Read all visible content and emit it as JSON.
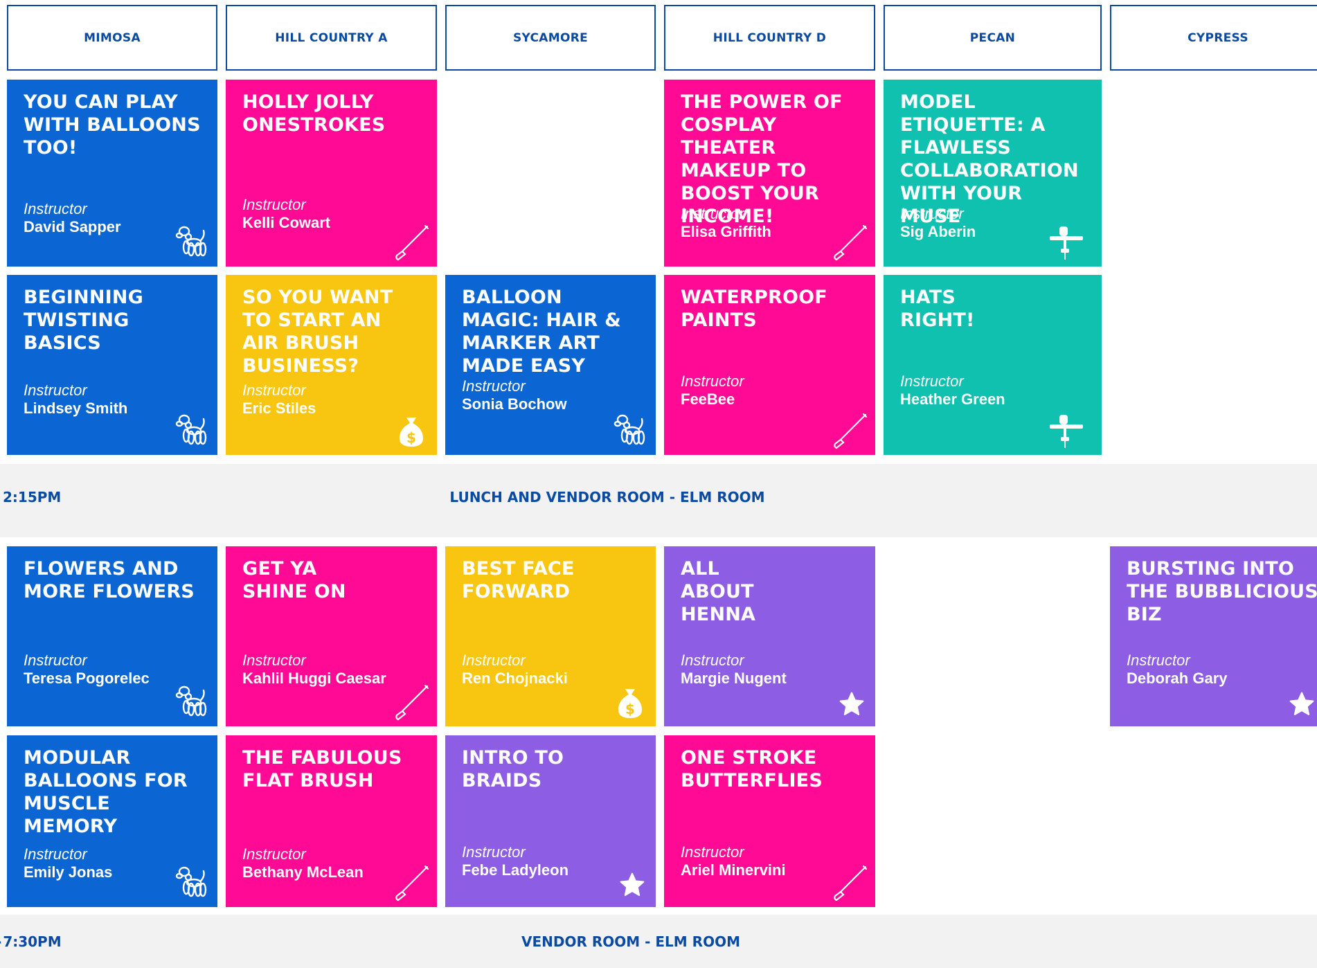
{
  "rooms": [
    "MIMOSA",
    "HILL COUNTRY A",
    "SYCAMORE",
    "HILL COUNTRY D",
    "PECAN",
    "CYPRESS"
  ],
  "instructor_label": "Instructor",
  "sessions_block1": [
    {
      "title": "YOU CAN PLAY WITH BALLOONS TOO!",
      "instructor": "David Sapper",
      "icon": "balloon-dog-icon",
      "color": "#0b66d4"
    },
    {
      "title": "HOLLY JOLLY ONESTROKES",
      "instructor": "Kelli Cowart",
      "icon": "paintbrush-icon",
      "color": "#ff0a95"
    },
    {
      "title": "THE POWER OF COSPLAY THEATER MAKEUP TO BOOST YOUR INCOME!",
      "instructor": "Elisa Griffith",
      "icon": "paintbrush-icon",
      "color": "#ff0a95"
    },
    {
      "title": "MODEL ETIQUETTE: A FLAWLESS COLLABORATION WITH YOUR MUSE",
      "instructor": "Sig Aberin",
      "icon": "airbrush-icon",
      "color": "#10c1b0"
    },
    {
      "title": "BEGINNING TWISTING BASICS",
      "instructor": "Lindsey Smith",
      "icon": "balloon-dog-icon",
      "color": "#0b66d4"
    },
    {
      "title": "SO YOU WANT TO START AN AIR BRUSH BUSINESS?",
      "instructor": "Eric Stiles",
      "icon": "money-bag-icon",
      "color": "#f8c611"
    },
    {
      "title": "BALLOON  MAGIC: HAIR & MARKER ART MADE EASY",
      "instructor": "Sonia Bochow",
      "icon": "balloon-dog-icon",
      "color": "#0b66d4"
    },
    {
      "title": "WATERPROOF PAINTS",
      "instructor": "FeeBee",
      "icon": "paintbrush-icon",
      "color": "#ff0a95"
    },
    {
      "title": "HATS RIGHT!",
      "instructor": "Heather Green",
      "icon": "airbrush-icon",
      "color": "#10c1b0"
    }
  ],
  "band1": {
    "time": "2:15PM",
    "label": "LUNCH AND VENDOR ROOM - ELM ROOM"
  },
  "sessions_block2": [
    {
      "title": "FLOWERS AND MORE FLOWERS",
      "instructor": "Teresa Pogorelec",
      "icon": "balloon-dog-icon",
      "color": "#0b66d4"
    },
    {
      "title": "GET YA SHINE  ON",
      "instructor": "Kahlil Huggi Caesar",
      "icon": "paintbrush-icon",
      "color": "#ff0a95"
    },
    {
      "title": "BEST FACE FORWARD",
      "instructor": "Ren Chojnacki",
      "icon": "money-bag-icon",
      "color": "#f8c611"
    },
    {
      "title": "ALL ABOUT HENNA",
      "instructor": "Margie Nugent",
      "icon": "star-icon",
      "color": "#8d5ee3"
    },
    {
      "title": "BURSTING INTO THE BUBBLICIOUS BIZ",
      "instructor": "Deborah Gary",
      "icon": "star-icon",
      "color": "#8d5ee3"
    },
    {
      "title": "MODULAR BALLOONS FOR MUSCLE MEMORY",
      "instructor": "Emily Jonas",
      "icon": "balloon-dog-icon",
      "color": "#0b66d4"
    },
    {
      "title": "THE FABULOUS FLAT BRUSH",
      "instructor": "Bethany McLean",
      "icon": "paintbrush-icon",
      "color": "#ff0a95"
    },
    {
      "title": "INTRO TO BRAIDS",
      "instructor": "Febe Ladyleon",
      "icon": "star-icon",
      "color": "#8d5ee3"
    },
    {
      "title": "ONE STROKE BUTTERFLIES",
      "instructor": "Ariel Minervini",
      "icon": "paintbrush-icon",
      "color": "#ff0a95"
    }
  ],
  "band2": {
    "time": "7:30PM",
    "label": "VENDOR ROOM - ELM ROOM"
  }
}
